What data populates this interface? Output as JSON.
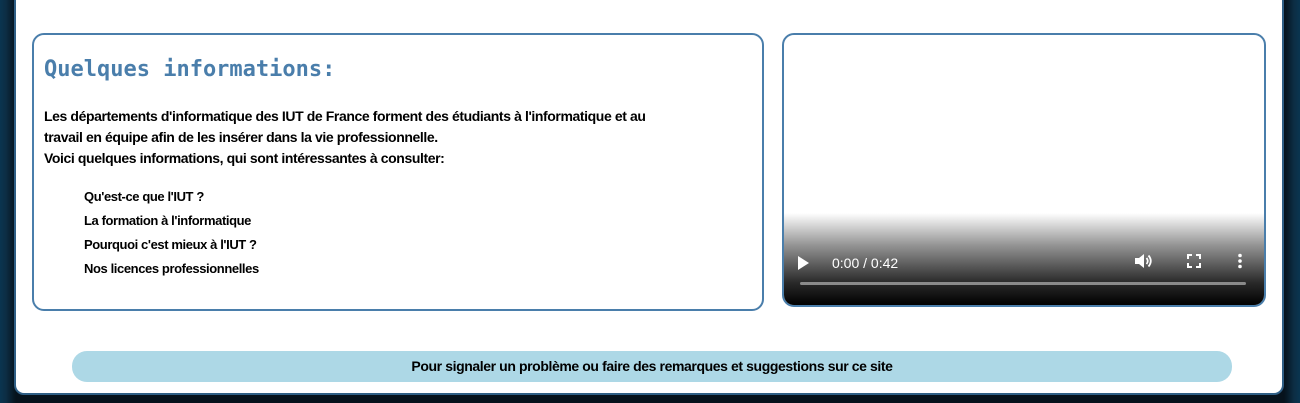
{
  "info": {
    "title": "Quelques informations:",
    "paragraph_line1": "Les départements d'informatique des IUT de France forment des étudiants à l'informatique et au",
    "paragraph_line2": "travail en équipe afin de les insérer dans la vie professionnelle.",
    "paragraph_line3": "Voici quelques informations, qui sont intéressantes à consulter:",
    "links": [
      {
        "label": "Qu'est-ce que l'IUT ?"
      },
      {
        "label": "La formation à l'informatique"
      },
      {
        "label": "Pourquoi c'est mieux à l'IUT ?"
      },
      {
        "label": "Nos licences professionnelles"
      }
    ]
  },
  "video": {
    "time": "0:00 / 0:42",
    "progress": 0,
    "icons": [
      "play-icon",
      "volume-icon",
      "fullscreen-icon",
      "more-options-icon"
    ]
  },
  "footer": {
    "report_label": "Pour signaler un problème ou faire des remarques et suggestions sur ce site"
  },
  "colors": {
    "accent": "#4a7eab",
    "footer_bg": "#add8e6",
    "page_border": "#2f5f86"
  }
}
